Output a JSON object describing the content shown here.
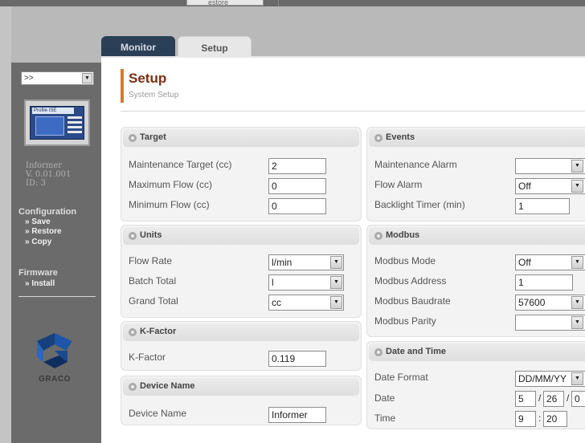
{
  "top": {
    "store_label": "estore"
  },
  "tabs": [
    {
      "label": "Monitor"
    },
    {
      "label": "Setup"
    }
  ],
  "sidebar": {
    "selector_value": ">>",
    "device": {
      "name": "Informer",
      "version": "V. 0.01.001",
      "id": "ID: 3",
      "thumb_label": "Profile ISE"
    },
    "configuration": {
      "heading": "Configuration",
      "links": [
        "» Save",
        "» Restore",
        "» Copy"
      ]
    },
    "firmware": {
      "heading": "Firmware",
      "links": [
        "» Install"
      ]
    },
    "logo_text": "GRACO"
  },
  "page": {
    "title": "Setup",
    "subtitle": "System Setup"
  },
  "target": {
    "title": "Target",
    "fields": [
      {
        "label": "Maintenance Target (cc)",
        "value": "2"
      },
      {
        "label": "Maximum Flow (cc)",
        "value": "0"
      },
      {
        "label": "Minimum Flow (cc)",
        "value": "0"
      }
    ]
  },
  "units": {
    "title": "Units",
    "fields": [
      {
        "label": "Flow Rate",
        "value": "l/min"
      },
      {
        "label": "Batch Total",
        "value": "l"
      },
      {
        "label": "Grand Total",
        "value": "cc"
      }
    ]
  },
  "kfactor": {
    "title": "K-Factor",
    "label": "K-Factor",
    "value": "0.119"
  },
  "device_name": {
    "title": "Device Name",
    "label": "Device Name",
    "value": "Informer"
  },
  "events": {
    "title": "Events",
    "fields": [
      {
        "label": "Maintenance Alarm",
        "value": ""
      },
      {
        "label": "Flow Alarm",
        "value": "Off"
      },
      {
        "label": "Backlight Timer (min)",
        "value": "1"
      }
    ]
  },
  "modbus": {
    "title": "Modbus",
    "fields": [
      {
        "label": "Modbus Mode",
        "value": "Off"
      },
      {
        "label": "Modbus Address",
        "value": "1"
      },
      {
        "label": "Modbus Baudrate",
        "value": "57600"
      },
      {
        "label": "Modbus Parity",
        "value": ""
      }
    ]
  },
  "datetime": {
    "title": "Date and Time",
    "format_label": "Date Format",
    "format_value": "DD/MM/YY",
    "date_label": "Date",
    "date_day": "5",
    "date_month": "26",
    "date_year": "0",
    "date_sep": "/",
    "time_label": "Time",
    "time_hour": "9",
    "time_minute": "20",
    "time_sep": ":"
  },
  "colors": {
    "accent_title": "#7a2f0f",
    "title_bar": "#d47a2a",
    "monitor_tab": "#2b3f56",
    "sidebar_bg": "#6b6b6b"
  },
  "icons": {
    "gear": "gear-icon",
    "dropdown": "chevron-down-icon"
  }
}
